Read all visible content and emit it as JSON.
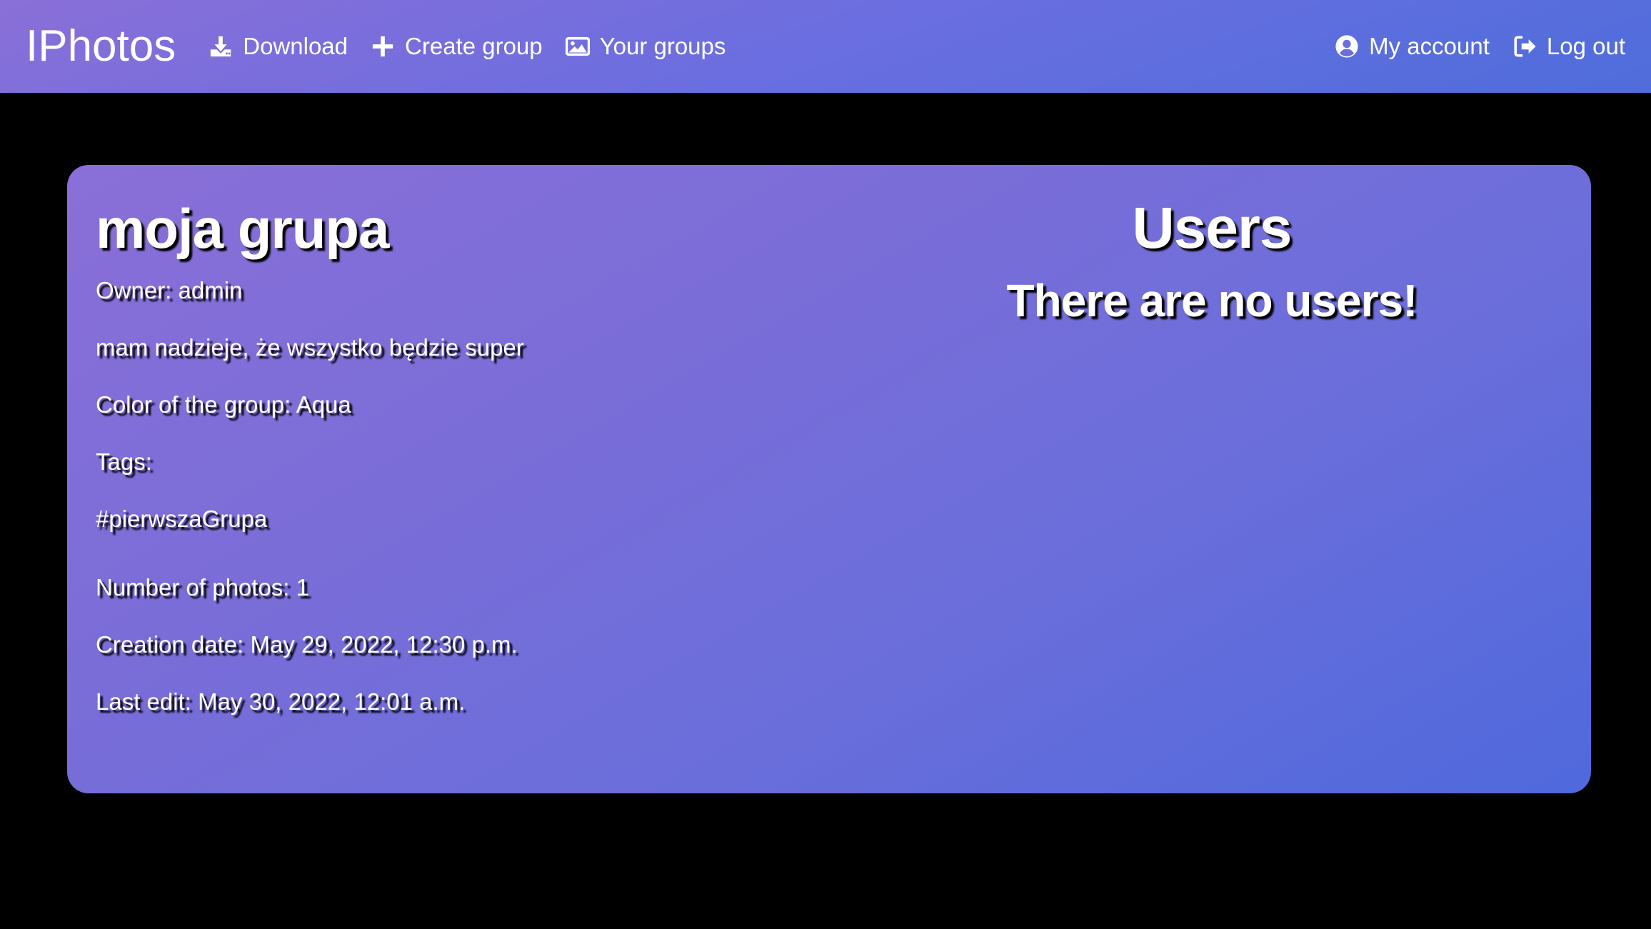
{
  "nav": {
    "brand": "IPhotos",
    "left": [
      {
        "label": "Download",
        "icon": "download-icon"
      },
      {
        "label": "Create group",
        "icon": "plus-icon"
      },
      {
        "label": "Your groups",
        "icon": "image-icon"
      }
    ],
    "right": [
      {
        "label": "My account",
        "icon": "user-circle-icon"
      },
      {
        "label": "Log out",
        "icon": "logout-icon"
      }
    ]
  },
  "group": {
    "name": "moja grupa",
    "owner": "Owner: admin",
    "description": "mam nadzieje, że wszystko będzie super",
    "color": "Color of the group: Aqua",
    "tags_label": "Tags:",
    "tags": [
      "#pierwszaGrupa"
    ],
    "photos": "Number of photos: 1",
    "created": "Creation date: May 29, 2022, 12:30 p.m.",
    "edited": "Last edit: May 30, 2022, 12:01 a.m."
  },
  "users": {
    "title": "Users",
    "empty_message": "There are no users!"
  },
  "colors": {
    "background": "#000000",
    "gradient_start": "#8a6fd8",
    "gradient_end": "#4f69dc",
    "text": "#ffffff"
  }
}
